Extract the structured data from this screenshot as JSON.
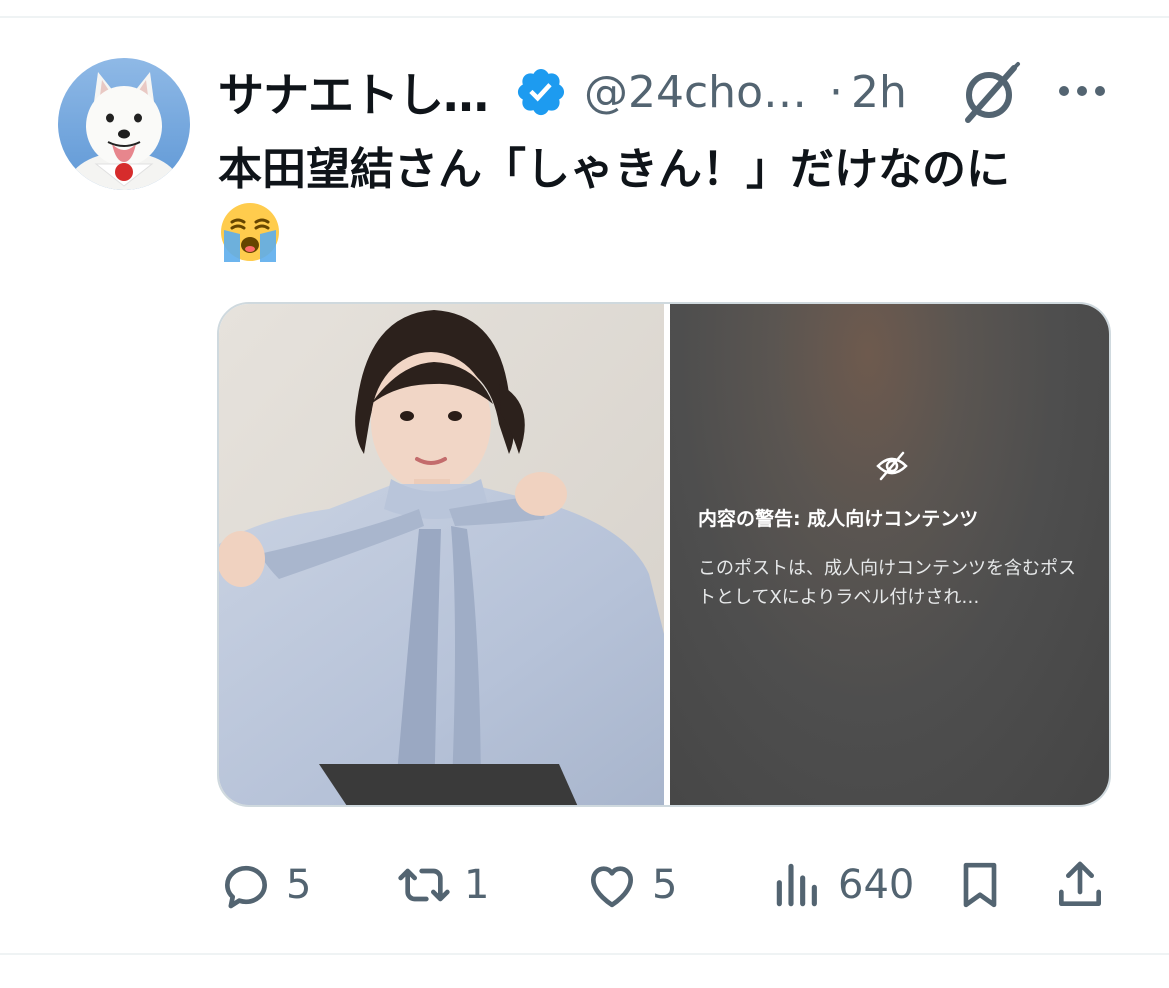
{
  "tweet": {
    "author": {
      "display_name": "サナエトし…",
      "handle": "@24cho…",
      "verified": true
    },
    "separator": "·",
    "time": "2h",
    "text": "本田望結さん「しゃきん！」だけなのに",
    "emoji": "loudly-crying-face",
    "media": {
      "warning_title": "内容の警告: 成人向けコンテンツ",
      "warning_body": "このポストは、成人向けコンテンツを含むポストとしてXによりラベル付けされ…"
    },
    "actions": {
      "replies": "5",
      "reposts": "1",
      "likes": "5",
      "views": "640"
    }
  },
  "colors": {
    "accent": "#1d9bf0",
    "muted": "#536471",
    "text": "#0f1419"
  }
}
